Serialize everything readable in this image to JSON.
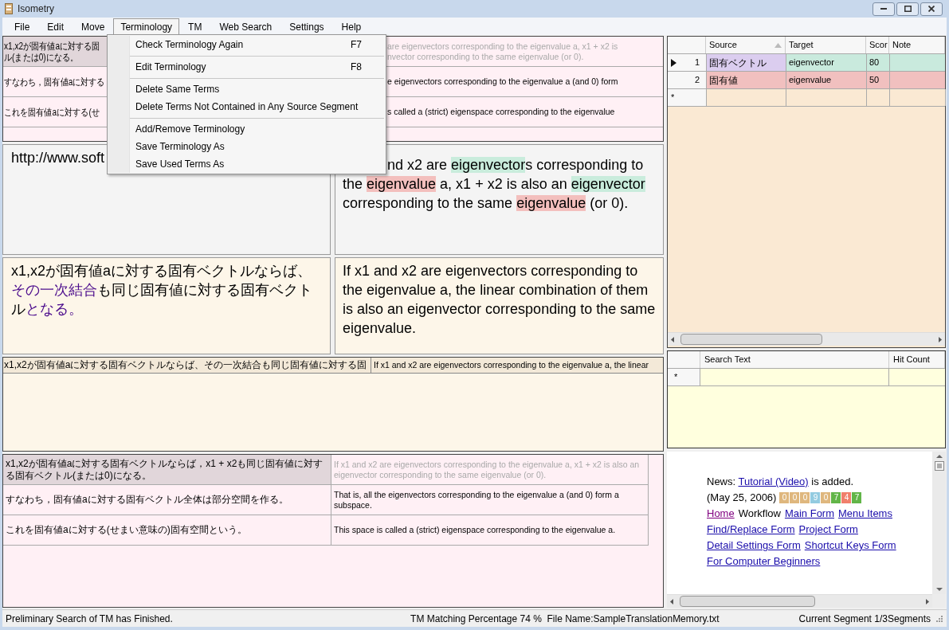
{
  "window": {
    "title": "Isometry"
  },
  "menu_bar": [
    {
      "label": "File",
      "selected": false
    },
    {
      "label": "Edit",
      "selected": false
    },
    {
      "label": "Move",
      "selected": false
    },
    {
      "label": "Terminology",
      "selected": true
    },
    {
      "label": "TM",
      "selected": false
    },
    {
      "label": "Web Search",
      "selected": false
    },
    {
      "label": "Settings",
      "selected": false
    },
    {
      "label": "Help",
      "selected": false
    }
  ],
  "menu": {
    "items": [
      {
        "kind": "item",
        "label": "Check Terminology Again",
        "shortcut": "F7"
      },
      {
        "kind": "separator"
      },
      {
        "kind": "item",
        "label": "Edit Terminology",
        "shortcut": "F8"
      },
      {
        "kind": "separator"
      },
      {
        "kind": "item",
        "label": "Delete Same Terms"
      },
      {
        "kind": "item",
        "label": "Delete Terms Not Contained in Any Source Segment"
      },
      {
        "kind": "separator"
      },
      {
        "kind": "item",
        "label": "Add/Remove Terminology"
      },
      {
        "kind": "item",
        "label": "Save Terminology As"
      },
      {
        "kind": "item",
        "label": "Save Used Terms As"
      }
    ]
  },
  "segment_grid_top": {
    "rows": [
      {
        "selected": true,
        "dimmed": true,
        "source_lines": [
          "x1,x2が固有値aに対する固",
          "ル(または0)になる。"
        ],
        "target_lines": [
          "are eigenvectors corresponding to the eigenvalue a, x1 + x2 is",
          "nvector corresponding to the same eigenvalue (or 0)."
        ]
      },
      {
        "selected": false,
        "dimmed": false,
        "source_lines": [
          "すなわち，固有値aに対する"
        ],
        "target_lines": [
          "e eigenvectors corresponding to the eigenvalue a (and 0) form"
        ]
      },
      {
        "selected": false,
        "dimmed": false,
        "source_lines": [
          "これを固有値aに対する(せ"
        ],
        "target_lines": [
          "s called a (strict) eigenspace corresponding to the eigenvalue"
        ]
      }
    ]
  },
  "source_editor": {
    "text": "http://www.soft"
  },
  "target_editor": {
    "segments": [
      {
        "text": "nd x2 are "
      },
      {
        "text": "eigenvector",
        "color": "#c9ecdc"
      },
      {
        "text": "s corresponding to the "
      },
      {
        "text": "eigenvalue",
        "color": "#f3bfbd"
      },
      {
        "text": " a, x1 + x2 is also an "
      },
      {
        "text": "eigenvector",
        "color": "#c9ecdc"
      },
      {
        "text": " corresponding to the same "
      },
      {
        "text": "eigenvalue",
        "color": "#f3bfbd"
      },
      {
        "text": " (or 0)."
      }
    ]
  },
  "source_preview": {
    "segments": [
      {
        "text": "x1,x2が固有値aに対する固有ベクトルならば、"
      },
      {
        "text": "その一次結合",
        "color": "#4b0b8c"
      },
      {
        "text": "も同じ固有値に対する固有ベクトル"
      },
      {
        "text": "となる。",
        "color": "#4b0b8c"
      }
    ]
  },
  "target_preview": {
    "text": "If x1 and x2 are eigenvectors corresponding to the eigenvalue a, the linear combination of them is also an eigenvector corresponding to the same eigenvalue."
  },
  "current_segment": {
    "source": "x1,x2が固有値aに対する固有ベクトルならば、その一次結合も同じ固有値に対する固",
    "target": "If x1 and x2 are eigenvectors corresponding to the eigenvalue a, the linear"
  },
  "segment_grid_bottom": {
    "rows": [
      {
        "selected": true,
        "dimmed": true,
        "source": "x1,x2が固有値aに対する固有ベクトルならば，x1 + x2も同じ固有値に対する固有ベクトル(または0)になる。",
        "target": "If x1 and x2 are eigenvectors corresponding to the eigenvalue a, x1 + x2 is also an eigenvector corresponding to the same eigenvalue (or 0)."
      },
      {
        "selected": false,
        "dimmed": false,
        "source": "すなわち，固有値aに対する固有ベクトル全体は部分空間を作る。",
        "target": "That is, all the eigenvectors corresponding to the eigenvalue a (and 0) form a subspace."
      },
      {
        "selected": false,
        "dimmed": false,
        "source": "これを固有値aに対する(せまい意味の)固有空間という。",
        "target": "This space is called a (strict) eigenspace corresponding to the eigenvalue a."
      }
    ]
  },
  "terminology_grid": {
    "columns": [
      {
        "label": "Source",
        "sorted": true
      },
      {
        "label": "Target",
        "sorted": false
      },
      {
        "label": "Scor",
        "sorted": false
      },
      {
        "label": "Note",
        "sorted": false
      }
    ],
    "rows": [
      {
        "number": "1",
        "current": true,
        "source_selected": true,
        "color": "#c9eadd",
        "source": "固有ベクトル",
        "target": "eigenvector",
        "score": "80"
      },
      {
        "number": "2",
        "current": false,
        "source_selected": false,
        "color": "#f1c0bf",
        "source": "固有値",
        "target": "eigenvalue",
        "score": "50"
      }
    ],
    "new_row": "*"
  },
  "search_grid": {
    "columns": [
      "Search Text",
      "Hit Count"
    ],
    "new_row": "*"
  },
  "news": {
    "prefix": "News: ",
    "link": "Tutorial (Video)",
    "suffix": " is added.",
    "date": "(May 25, 2006)",
    "counter": [
      {
        "digit": "0",
        "color": "#dfb77e"
      },
      {
        "digit": "0",
        "color": "#dfb77e"
      },
      {
        "digit": "0",
        "color": "#dfb77e"
      },
      {
        "digit": "9",
        "color": "#93cbe0"
      },
      {
        "digit": "0",
        "color": "#dfb77e"
      },
      {
        "digit": "7",
        "color": "#62b548"
      },
      {
        "digit": "4",
        "color": "#f07f6c"
      },
      {
        "digit": "7",
        "color": "#62b548"
      }
    ],
    "nav": [
      {
        "kind": "link",
        "label": "Home",
        "visited": true
      },
      {
        "kind": "text",
        "label": "Workflow"
      },
      {
        "kind": "link",
        "label": "Main Form",
        "visited": false
      },
      {
        "kind": "link",
        "label": "Menu Items",
        "visited": false
      },
      {
        "kind": "link",
        "label": "Find/Replace Form",
        "visited": false
      },
      {
        "kind": "link",
        "label": "Project Form",
        "visited": false
      },
      {
        "kind": "link",
        "label": "Detail Settings Form",
        "visited": false
      },
      {
        "kind": "link",
        "label": "Shortcut Keys Form",
        "visited": false
      },
      {
        "kind": "link",
        "label": "For Computer Beginners",
        "visited": false
      }
    ]
  },
  "status_bar": {
    "message": "Preliminary Search of TM has Finished.",
    "tm_info": "TM Matching Percentage 74 %  File Name:SampleTranslationMemory.txt",
    "segment": "Current Segment 1/3Segments"
  }
}
